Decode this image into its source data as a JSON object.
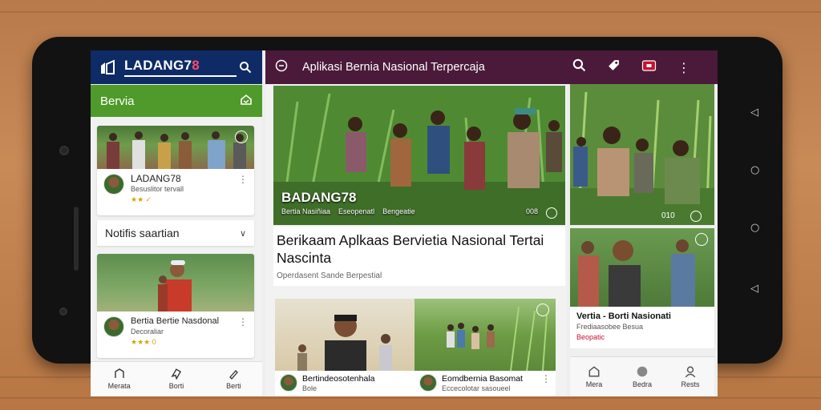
{
  "left_panel": {
    "app_name_prefix": "LADANG7",
    "app_name_suffix": "8",
    "section_title": "Bervia",
    "post1": {
      "author": "LADANG78",
      "subtitle": "Besuslitor tervall",
      "rating": "★★ ✓"
    },
    "notification_label": "Notifis saartian",
    "post2": {
      "title": "Bertia Bertie Nasdonal",
      "subtitle": "Decoraliar",
      "rating": "★★★ 0"
    },
    "bottom_nav": [
      {
        "label": "Merata",
        "icon": "home-icon"
      },
      {
        "label": "Borti",
        "icon": "bookmark-icon"
      },
      {
        "label": "Berti",
        "icon": "pen-icon"
      }
    ]
  },
  "middle_panel": {
    "toolbar_title": "Aplikasi Bernia Nasional Terpercaja",
    "hero": {
      "brand": "BADANG78",
      "meta": [
        "Bertia Nasiñiaa",
        "Eseopenatl",
        "Bengeatie"
      ],
      "count": "008"
    },
    "headline": "Berikaam Aplkaas Bervietia Nasional Tertai Nascinta",
    "headline_sub": "Operdasent Sande Berpestial",
    "mini1": {
      "title": "Bertindeosotenhala",
      "subtitle": "Bole"
    },
    "mini2": {
      "title": "Eomdbernia Basomat",
      "subtitle": "Eccecolotar sasoueel"
    }
  },
  "right_panel": {
    "hero_count": "010",
    "card": {
      "title": "Vertia - Borti Nasionati",
      "subtitle": "Frediaasobee Besua",
      "meta": "Beopatic"
    },
    "bottom_nav": [
      {
        "label": "Mera",
        "icon": "home-icon"
      },
      {
        "label": "Bedra",
        "icon": "circle-icon"
      },
      {
        "label": "Rests",
        "icon": "person-icon"
      }
    ]
  },
  "colors": {
    "left_header": "#0e2b66",
    "green_section": "#4f9a2b",
    "toolbar": "#4b1a3a",
    "brand_accent": "#ff4a6b"
  }
}
